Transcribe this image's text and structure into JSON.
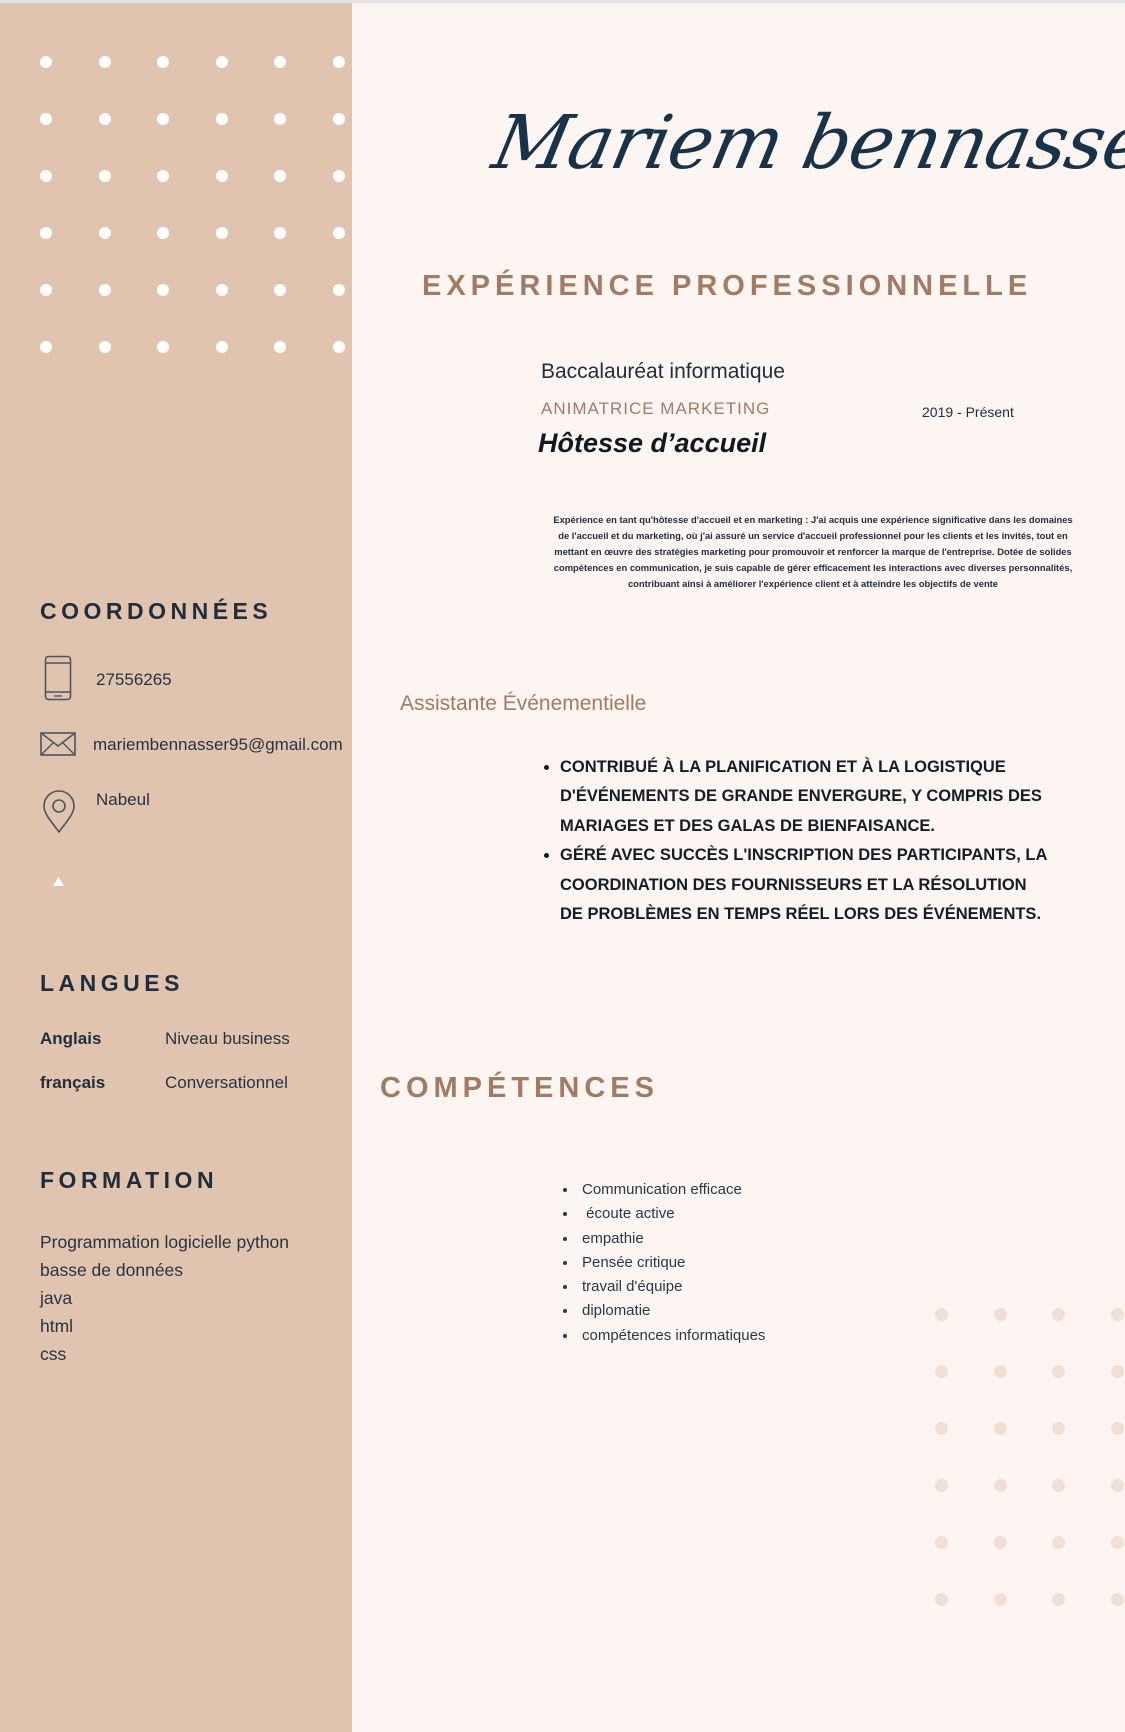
{
  "header": {
    "name": "Mariem bennasser"
  },
  "experience": {
    "title": "EXPÉRIENCE PROFESSIONNELLE",
    "degree": "Baccalauréat informatique",
    "role": "ANIMATRICE MARKETING",
    "dates": "2019 - Présent",
    "position": "Hôtesse d’accueil",
    "description": "Expérience en tant qu'hôtesse d'accueil et en marketing : J'ai acquis une expérience significative dans les domaines de l'accueil et du marketing, où j'ai assuré un service d'accueil professionnel pour les clients et les invités, tout en mettant en œuvre des stratégies marketing pour promouvoir et renforcer la marque de l'entreprise. Dotée de solides compétences en communication, je suis capable de gérer efficacement les interactions avec diverses personnalités, contribuant ainsi à améliorer l'expérience client et à atteindre les objectifs de vente",
    "second_role": "Assistante Événementielle",
    "bullets": [
      "CONTRIBUÉ À LA PLANIFICATION ET À LA LOGISTIQUE D'ÉVÉNEMENTS DE GRANDE ENVERGURE, Y COMPRIS DES MARIAGES ET DES GALAS DE BIENFAISANCE.",
      "GÉRÉ AVEC SUCCÈS L'INSCRIPTION DES PARTICIPANTS, LA COORDINATION DES FOURNISSEURS ET LA RÉSOLUTION DE PROBLÈMES EN TEMPS RÉEL LORS DES ÉVÉNEMENTS."
    ]
  },
  "skills": {
    "title": "COMPÉTENCES",
    "items": [
      "Communication efficace",
      " écoute active",
      "empathie",
      "Pensée critique",
      "travail d'équipe",
      "diplomatie",
      "compétences informatiques"
    ]
  },
  "contact": {
    "title": "COORDONNÉES",
    "phone": "27556265",
    "email": "mariembennasser95@gmail.com",
    "location": "Nabeul",
    "icons": [
      "phone-icon",
      "mail-icon",
      "location-pin-icon",
      "triangle-icon"
    ]
  },
  "languages": {
    "title": "LANGUES",
    "items": [
      {
        "name": "Anglais",
        "level": "Niveau business"
      },
      {
        "name": "français",
        "level": "Conversationnel"
      }
    ]
  },
  "formation": {
    "title": "FORMATION",
    "items": [
      "Programmation logicielle python",
      "basse de données",
      "java",
      "html",
      "css"
    ]
  },
  "colors": {
    "sidebar": "#e1c4b0",
    "page": "#fdf5f1",
    "accent": "#a27b62",
    "navy": "#18324a"
  }
}
